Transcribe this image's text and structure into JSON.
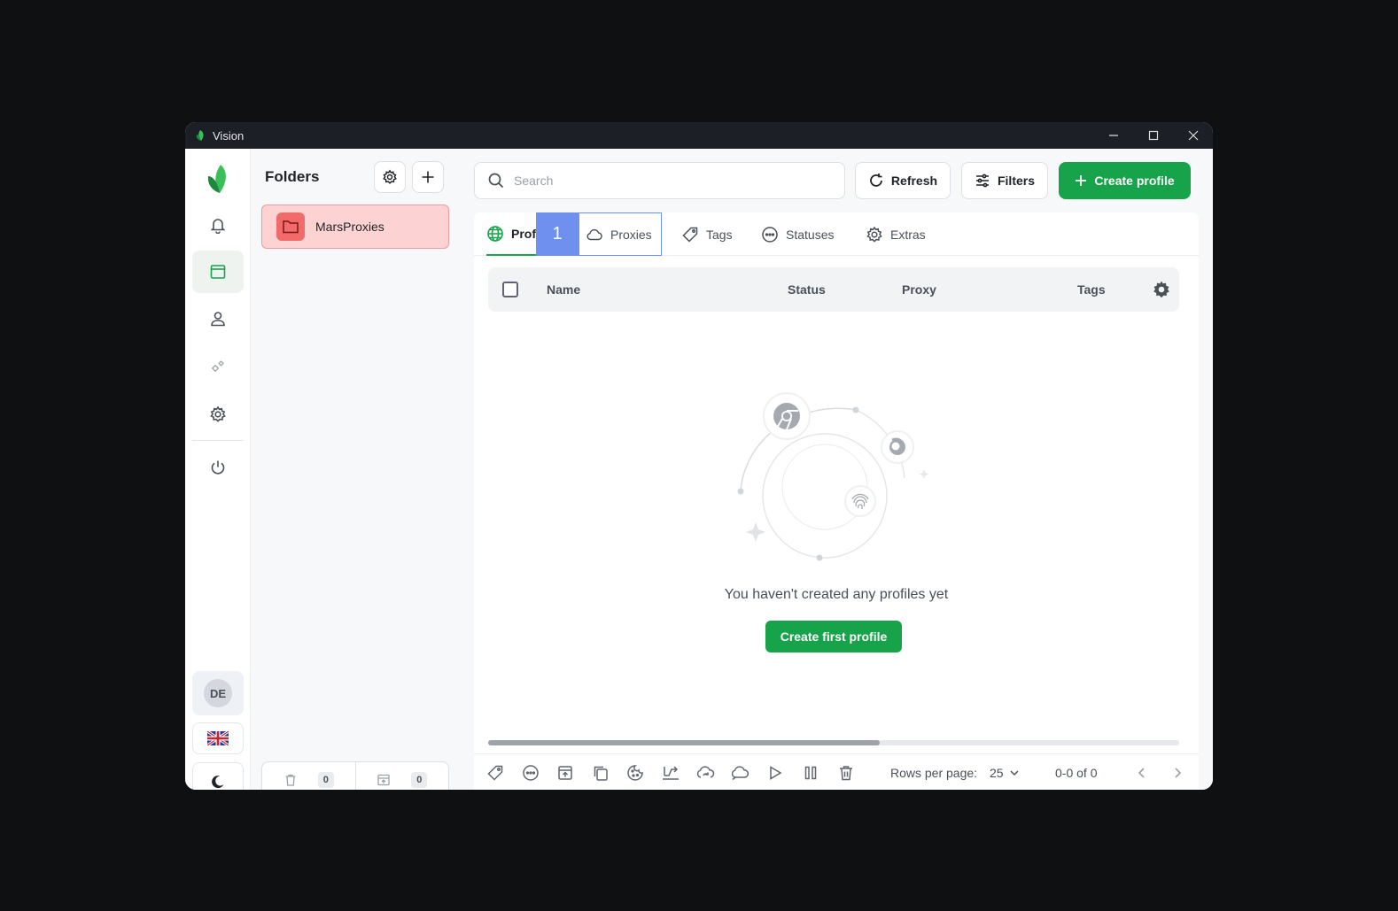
{
  "window": {
    "title": "Vision"
  },
  "rail": {
    "avatar_initials": "DE"
  },
  "folders": {
    "title": "Folders",
    "items": [
      {
        "name": "MarsProxies",
        "color": "#f26b6b"
      }
    ],
    "footer": {
      "trash_count": "0",
      "archive_count": "0"
    }
  },
  "toolbar": {
    "search_placeholder": "Search",
    "refresh_label": "Refresh",
    "filters_label": "Filters",
    "create_label": "Create profile"
  },
  "tabs": {
    "profiles_label": "Prof",
    "overlay_label": "1",
    "proxies_label": "Proxies",
    "tags_label": "Tags",
    "statuses_label": "Statuses",
    "extras_label": "Extras"
  },
  "table": {
    "columns": {
      "name": "Name",
      "status": "Status",
      "proxy": "Proxy",
      "tags": "Tags"
    }
  },
  "empty": {
    "message": "You haven't created any profiles yet",
    "button_label": "Create first profile"
  },
  "pagination": {
    "rows_per_page_label": "Rows per page:",
    "rows_per_page_value": "25",
    "range_text": "0-0 of 0"
  },
  "colors": {
    "accent": "#16a34a",
    "overlay": "#6f90ef",
    "folder_bg": "#fcd2d2"
  }
}
